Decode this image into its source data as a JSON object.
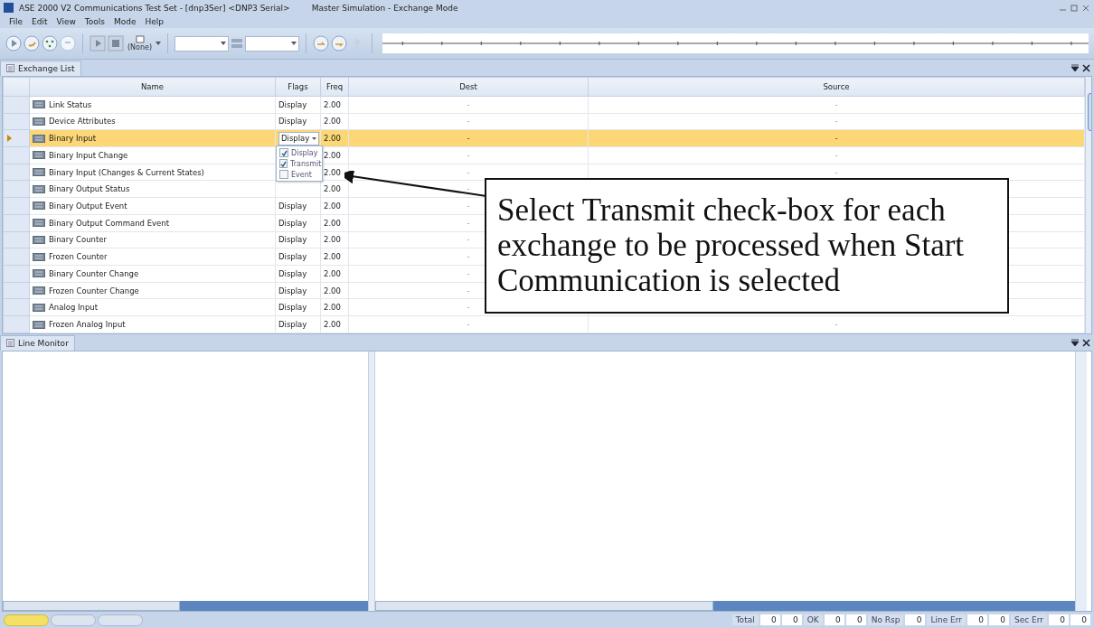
{
  "window": {
    "title": "ASE 2000 V2 Communications Test Set - [dnp3Ser] <DNP3 Serial>",
    "mode": "Master Simulation - Exchange Mode"
  },
  "menu": [
    "File",
    "Edit",
    "View",
    "Tools",
    "Mode",
    "Help"
  ],
  "toolbar": {
    "none_label": "(None)"
  },
  "exchange_list": {
    "title": "Exchange List",
    "columns": [
      "Name",
      "Flags",
      "Freq",
      "Dest",
      "Source"
    ],
    "rows": [
      {
        "name": "Link Status",
        "flags": "Display",
        "freq": "2.00",
        "dest": "-",
        "source": "-",
        "selected": false
      },
      {
        "name": "Device Attributes",
        "flags": "Display",
        "freq": "2.00",
        "dest": "-",
        "source": "-",
        "selected": false
      },
      {
        "name": "Binary Input",
        "flags": "Display",
        "freq": "2.00",
        "dest": "-",
        "source": "-",
        "selected": true
      },
      {
        "name": "Binary Input Change",
        "freq": "2.00",
        "dest": "-",
        "source": "-",
        "selected": false
      },
      {
        "name": "Binary Input (Changes & Current States)",
        "freq": "2.00",
        "dest": "-",
        "source": "-",
        "selected": false
      },
      {
        "name": "Binary Output Status",
        "freq": "2.00",
        "dest": "-",
        "selected": false
      },
      {
        "name": "Binary Output Event",
        "flags": "Display",
        "freq": "2.00",
        "dest": "-",
        "selected": false
      },
      {
        "name": "Binary Output Command Event",
        "flags": "Display",
        "freq": "2.00",
        "dest": "-",
        "selected": false
      },
      {
        "name": "Binary Counter",
        "flags": "Display",
        "freq": "2.00",
        "dest": "-",
        "selected": false
      },
      {
        "name": "Frozen Counter",
        "flags": "Display",
        "freq": "2.00",
        "dest": "-",
        "selected": false
      },
      {
        "name": "Binary Counter Change",
        "flags": "Display",
        "freq": "2.00",
        "dest": "-",
        "selected": false
      },
      {
        "name": "Frozen Counter Change",
        "flags": "Display",
        "freq": "2.00",
        "dest": "-",
        "selected": false
      },
      {
        "name": "Analog Input",
        "flags": "Display",
        "freq": "2.00",
        "dest": "-",
        "selected": false
      },
      {
        "name": "Frozen Analog Input",
        "flags": "Display",
        "freq": "2.00",
        "dest": "-",
        "source": "-",
        "selected": false
      }
    ],
    "flags_dropdown": [
      {
        "label": "Display",
        "checked": true
      },
      {
        "label": "Transmit",
        "checked": true
      },
      {
        "label": "Event",
        "checked": false
      }
    ]
  },
  "callout": {
    "text": "Select Transmit check-box for each exchange to be processed when Start Communication is selected"
  },
  "line_monitor": {
    "title": "Line Monitor"
  },
  "bottom_tabs": [
    {
      "selected": true
    },
    {
      "selected": false
    },
    {
      "selected": false
    }
  ],
  "status_bar": [
    {
      "kind": "label",
      "text": "Total"
    },
    {
      "kind": "count",
      "text": "0"
    },
    {
      "kind": "count",
      "text": "0"
    },
    {
      "kind": "label",
      "text": "OK"
    },
    {
      "kind": "count",
      "text": "0"
    },
    {
      "kind": "count",
      "text": "0"
    },
    {
      "kind": "label",
      "text": "No Rsp"
    },
    {
      "kind": "count",
      "text": "0"
    },
    {
      "kind": "label",
      "text": "Line Err"
    },
    {
      "kind": "count",
      "text": "0"
    },
    {
      "kind": "count",
      "text": "0"
    },
    {
      "kind": "label",
      "text": "Sec Err"
    },
    {
      "kind": "count",
      "text": "0"
    },
    {
      "kind": "count",
      "text": "0"
    }
  ]
}
